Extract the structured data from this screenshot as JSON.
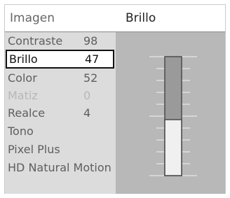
{
  "header": {
    "left": "Imagen",
    "right": "Brillo"
  },
  "menu": [
    {
      "label": "Contraste",
      "value": "98"
    },
    {
      "label": "Brillo",
      "value": "47",
      "selected": true
    },
    {
      "label": "Color",
      "value": "52"
    },
    {
      "label": "Matiz",
      "value": "0",
      "disabled": true
    },
    {
      "label": "Realce",
      "value": "4"
    },
    {
      "label": "Tono",
      "value": ""
    },
    {
      "label": "Pixel Plus",
      "value": ""
    },
    {
      "label": "HD Natural Motion",
      "value": ""
    }
  ],
  "slider": {
    "value": 47,
    "min": 0,
    "max": 100
  }
}
